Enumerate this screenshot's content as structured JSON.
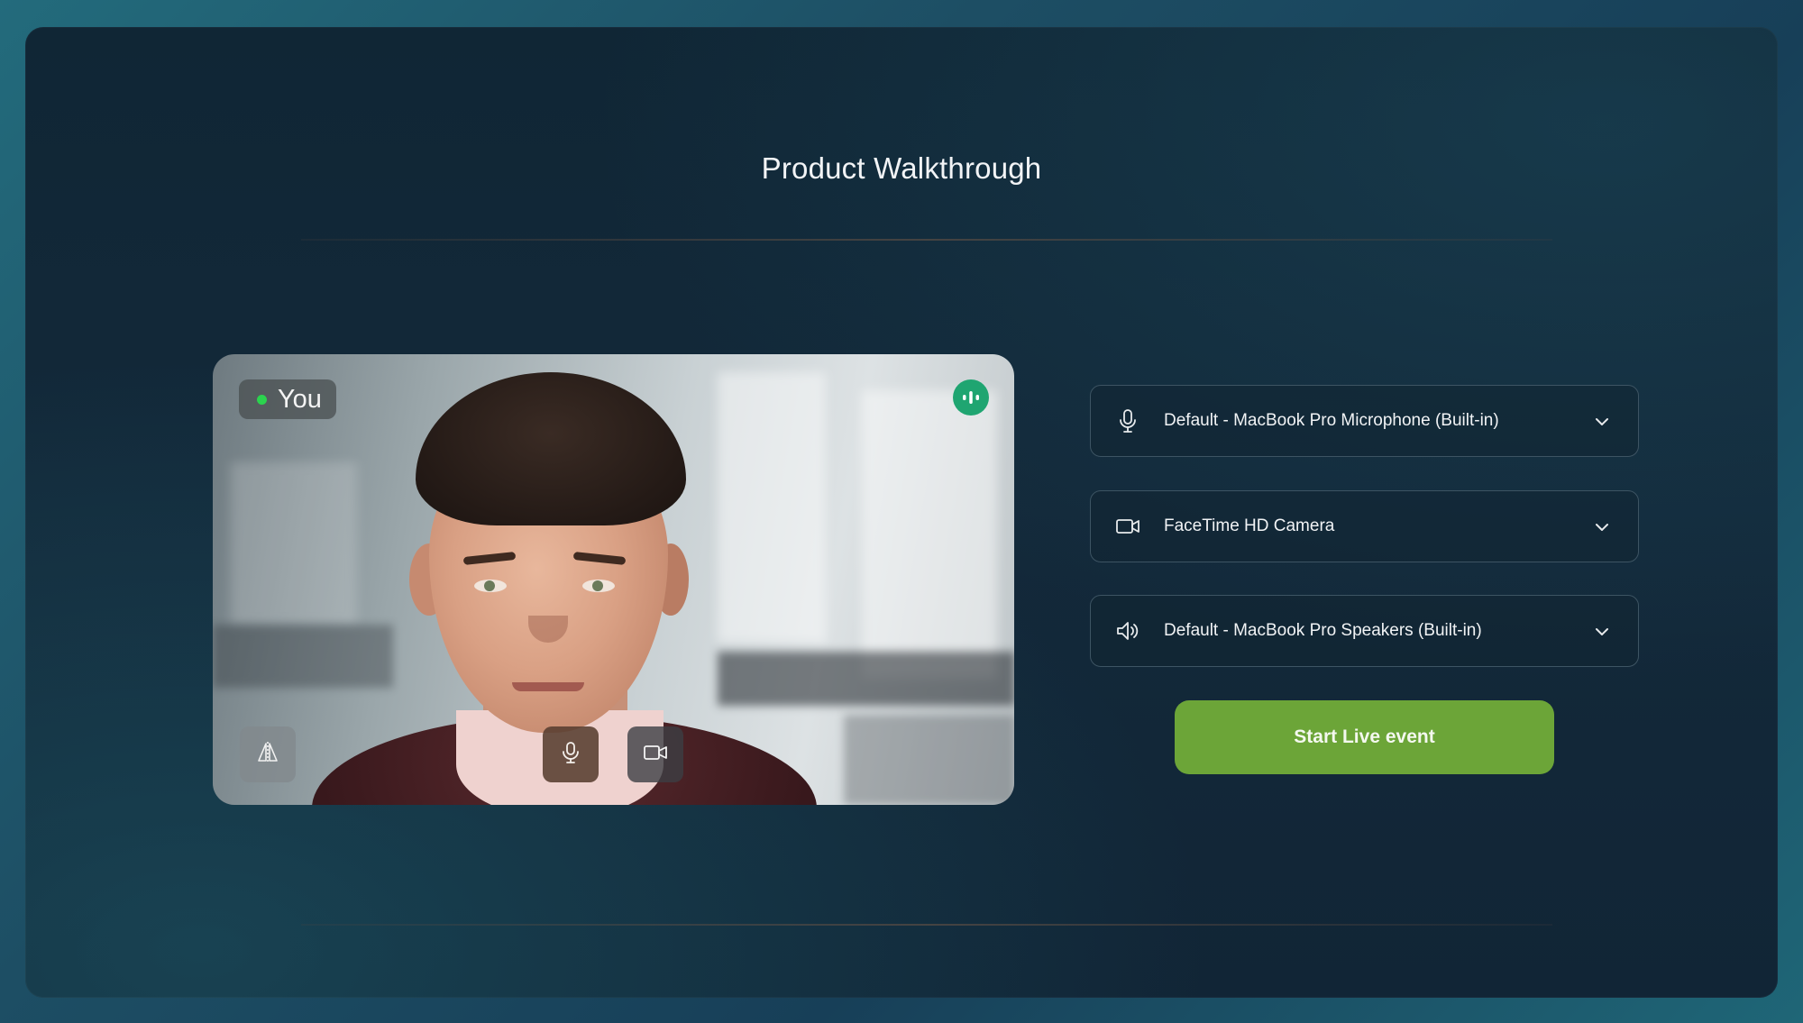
{
  "page": {
    "title": "Product Walkthrough"
  },
  "video_preview": {
    "self_label": "You",
    "status_dot_color": "#2bd34e",
    "audio_indicator_color": "#1fa571",
    "controls": [
      {
        "name": "mirror-toggle",
        "icon": "mirror-flip-icon"
      },
      {
        "name": "microphone-toggle",
        "icon": "microphone-icon"
      },
      {
        "name": "camera-toggle",
        "icon": "video-camera-icon"
      }
    ]
  },
  "devices": {
    "microphone": {
      "icon": "microphone-icon",
      "selected": "Default - MacBook Pro Microphone (Built-in)"
    },
    "camera": {
      "icon": "video-camera-icon",
      "selected": "FaceTime HD Camera"
    },
    "speaker": {
      "icon": "speaker-icon",
      "selected": "Default - MacBook Pro Speakers (Built-in)"
    }
  },
  "actions": {
    "start_label": "Start Live event",
    "start_color": "#6ca538"
  }
}
